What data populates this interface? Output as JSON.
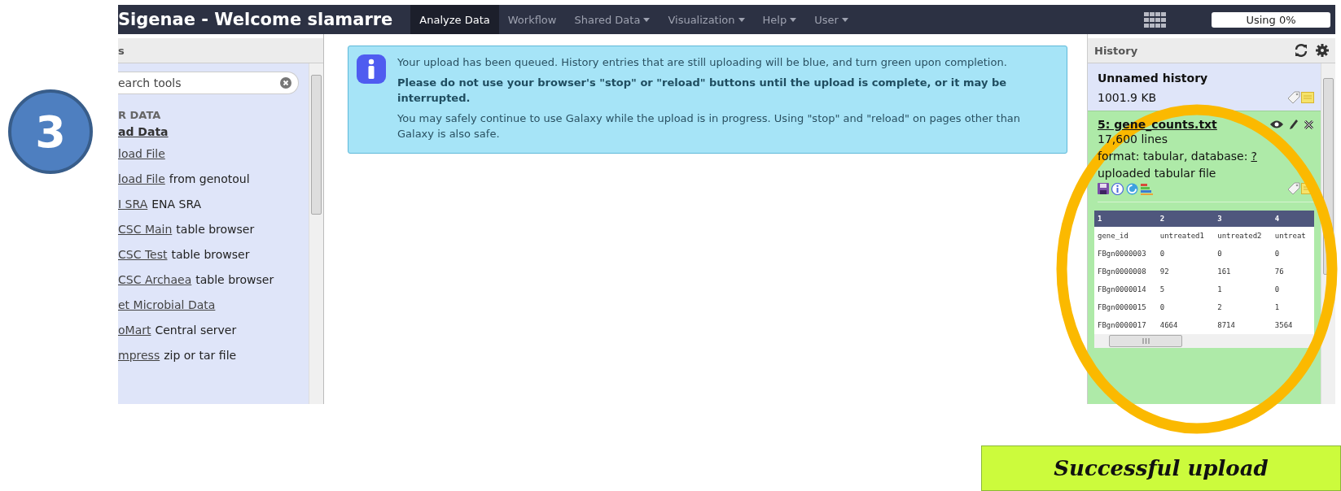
{
  "annotation": {
    "step": "3",
    "caption": "Successful upload"
  },
  "navbar": {
    "brand": "Sigenae - Welcome slamarre",
    "items": [
      {
        "label": "Analyze Data",
        "selected": true,
        "dropdown": false
      },
      {
        "label": "Workflow",
        "selected": false,
        "dropdown": false
      },
      {
        "label": "Shared Data",
        "selected": false,
        "dropdown": true
      },
      {
        "label": "Visualization",
        "selected": false,
        "dropdown": true
      },
      {
        "label": "Help",
        "selected": false,
        "dropdown": true
      },
      {
        "label": "User",
        "selected": false,
        "dropdown": true
      }
    ],
    "quota": {
      "label": "Using 0%",
      "level": 0
    }
  },
  "tool_panel": {
    "title": "s",
    "search": {
      "placeholder": "earch tools"
    },
    "section": "R DATA",
    "items": [
      {
        "kind": "heading",
        "link": "ad Data"
      },
      {
        "kind": "tool",
        "link": "load File"
      },
      {
        "kind": "tool",
        "link": "load File",
        "rest": "from genotoul"
      },
      {
        "kind": "tool",
        "link": "I SRA",
        "rest": "ENA SRA"
      },
      {
        "kind": "tool",
        "link": "CSC Main",
        "rest": "table browser"
      },
      {
        "kind": "tool",
        "link": "CSC Test",
        "rest": "table browser"
      },
      {
        "kind": "tool",
        "link": "CSC Archaea",
        "rest": "table browser"
      },
      {
        "kind": "tool",
        "link": "et Microbial Data"
      },
      {
        "kind": "tool",
        "link": "oMart",
        "rest": "Central server"
      },
      {
        "kind": "tool",
        "link": "mpress",
        "rest": "zip or tar file"
      }
    ]
  },
  "message": {
    "paragraphs": [
      {
        "text": "Your upload has been queued. History entries that are still uploading will be blue, and turn green upon completion.",
        "bold": false
      },
      {
        "text": "Please do not use your browser's \"stop\" or \"reload\" buttons until the upload is complete, or it may be interrupted.",
        "bold": true
      },
      {
        "text": "You may safely continue to use Galaxy while the upload is in progress. Using \"stop\" and \"reload\" on pages other than Galaxy is also safe.",
        "bold": false
      }
    ]
  },
  "history": {
    "title": "History",
    "name": "Unnamed history",
    "size": "1001.9 KB",
    "dataset": {
      "title": "5: gene_counts.txt",
      "lines": "17,600 lines",
      "format": "format: tabular, database:",
      "db_link": "?",
      "info": "uploaded tabular file",
      "peek": {
        "columns": [
          "1",
          "2",
          "3",
          "4"
        ],
        "rows": [
          [
            "gene_id",
            "untreated1",
            "untreated2",
            "untreat"
          ],
          [
            "FBgn0000003",
            "0",
            "0",
            "0"
          ],
          [
            "FBgn0000008",
            "92",
            "161",
            "76"
          ],
          [
            "FBgn0000014",
            "5",
            "1",
            "0"
          ],
          [
            "FBgn0000015",
            "0",
            "2",
            "1"
          ],
          [
            "FBgn0000017",
            "4664",
            "8714",
            "3564"
          ]
        ]
      }
    }
  }
}
